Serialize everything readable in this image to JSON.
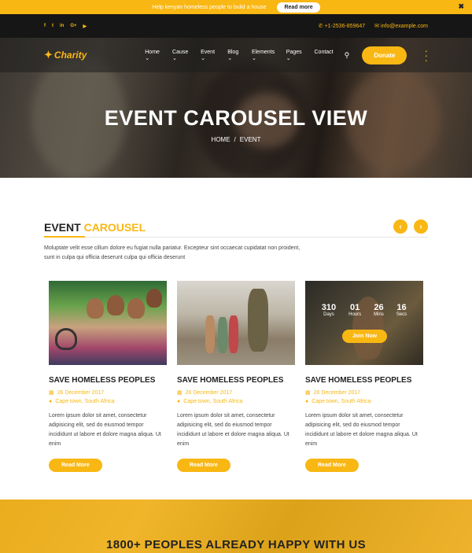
{
  "announcement": {
    "text": "Help kenyan homeless people to build a house",
    "button": "Read more",
    "close": "✖"
  },
  "topbar": {
    "socials": [
      "f",
      "t",
      "in",
      "G+",
      "▶"
    ],
    "phone": "+1-2536-859647",
    "email": "info@example.com"
  },
  "nav": {
    "logo": "Charity",
    "items": [
      "Home",
      "Cause",
      "Event",
      "Blog",
      "Elements",
      "Pages",
      "Contact"
    ],
    "donate": "Donate"
  },
  "hero": {
    "title": "EVENT CAROUSEL VIEW",
    "breadcrumb": {
      "home": "HOME",
      "sep": "/",
      "current": "EVENT"
    }
  },
  "section": {
    "title": "EVENT",
    "title_highlight": "CAROUSEL",
    "description": "Moluptate velit esse cillum dolore eu fugiat nulla pariatur. Excepteur sint occaecat cupidatat non proident, sunt in culpa qui officia deserunt culpa qui officia deserunt",
    "prev": "‹",
    "next": "›"
  },
  "cards": [
    {
      "title": "SAVE HOMELESS PEOPLES",
      "date": "26 December 2017",
      "location": "Cape town, South Africa",
      "text": "Lorem ipsum dolor sit amet, consectetur adipisicing elit, sed do eiusmod tempor incididunt ut labore et dolore magna aliqua. Ut enim",
      "button": "Read More"
    },
    {
      "title": "SAVE HOMELESS PEOPLES",
      "date": "26 December 2017",
      "location": "Cape town, South Africa",
      "text": "Lorem ipsum dolor sit amet, consectetur adipisicing elit, sed do eiusmod tempor incididunt ut labore et dolore magna aliqua. Ut enim",
      "button": "Read More"
    },
    {
      "title": "SAVE HOMELESS PEOPLES",
      "date": "26 December 2017",
      "location": "Cape town, South Africa",
      "text": "Lorem ipsum dolor sit amet, consectetur adipisicing elit, sed do eiusmod tempor incididunt ut labore et dolore magna aliqua. Ut enim",
      "button": "Read More"
    }
  ],
  "countdown": {
    "days": "310",
    "days_label": "Days",
    "hours": "01",
    "hours_label": "Hours",
    "mins": "26",
    "mins_label": "Mins",
    "secs": "16",
    "secs_label": "Secs",
    "button": "Join Now"
  },
  "banner": {
    "title": "1800+ PEOPLES ALREADY HAPPY WITH US"
  },
  "colors": {
    "accent": "#f9b713",
    "dark": "#161616"
  }
}
